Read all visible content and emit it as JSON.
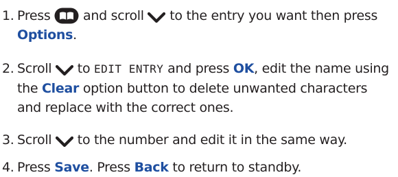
{
  "colors": {
    "text": "#231f20",
    "keyword": "#1f4fa0"
  },
  "icons": {
    "phonebook": "phonebook-key-icon",
    "scroll": "scroll-down-chevron-icon"
  },
  "steps": [
    {
      "number": "1.",
      "t1": "Press",
      "t2": "and scroll",
      "t3": "to the entry you want then press",
      "kw1": "Options",
      "t4": "."
    },
    {
      "number": "2.",
      "t1": "Scroll",
      "t2": "to",
      "lcd": "EDIT ENTRY",
      "t3": "and press",
      "kw1": "OK",
      "t4": ", edit the name using the",
      "kw2": "Clear",
      "t5": "option button to delete unwanted characters and replace with the correct ones."
    },
    {
      "number": "3.",
      "t1": "Scroll",
      "t2": "to the number and edit it in the same way."
    },
    {
      "number": "4.",
      "t1": "Press",
      "kw1": "Save",
      "t2": ". Press",
      "kw2": "Back",
      "t3": "to return to standby."
    }
  ]
}
